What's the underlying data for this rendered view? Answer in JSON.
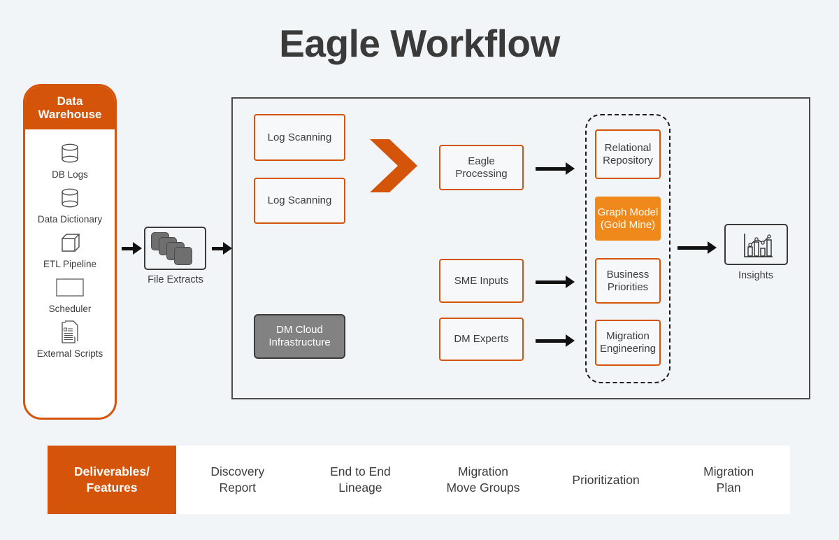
{
  "page": {
    "title": "Eagle Workflow",
    "background_color": "#f2f5f8",
    "accent_orange_dark": "#d4540a",
    "accent_orange_bright": "#f0891c",
    "gray_fill": "#828282"
  },
  "data_warehouse": {
    "header": "Data\nWarehouse",
    "header_line1": "Data",
    "header_line2": "Warehouse",
    "items": [
      {
        "label": "DB Logs",
        "icon": "database-cylinder-icon"
      },
      {
        "label": "Data Dictionary",
        "icon": "database-cylinder-icon"
      },
      {
        "label": "ETL Pipeline",
        "icon": "cube-icon"
      },
      {
        "label": "Scheduler",
        "icon": "rectangle-icon"
      },
      {
        "label": "External Scripts",
        "icon": "document-script-icon"
      }
    ]
  },
  "file_extracts": {
    "label": "File Extracts",
    "icon": "stacked-files-icon"
  },
  "workflow": {
    "left_column": [
      {
        "label": "Log Scanning",
        "style": "outline-orange"
      },
      {
        "label": "Log Scanning",
        "style": "outline-orange"
      },
      {
        "label": "DM Cloud Infrastructure",
        "style": "filled-gray"
      }
    ],
    "chevron_icon": "chevron-right-icon",
    "middle_column": [
      {
        "label": "Eagle Processing",
        "style": "outline-orange"
      },
      {
        "label": "SME Inputs",
        "style": "outline-orange"
      },
      {
        "label": "DM Experts",
        "style": "outline-orange"
      }
    ],
    "right_group": [
      {
        "label": "Relational Repository",
        "style": "outline-orange"
      },
      {
        "label": "Graph Model (Gold Mine)",
        "style": "filled-orange"
      },
      {
        "label": "Business Priorities",
        "style": "outline-orange"
      },
      {
        "label": "Migration Engineering",
        "style": "outline-orange"
      }
    ]
  },
  "insights": {
    "label": "Insights",
    "icon": "bar-chart-line-icon"
  },
  "deliverables": {
    "heading": "Deliverables/ Features",
    "items": [
      "Discovery Report",
      "End to End Lineage",
      "Migration Move Groups",
      "Prioritization",
      "Migration Plan"
    ]
  }
}
